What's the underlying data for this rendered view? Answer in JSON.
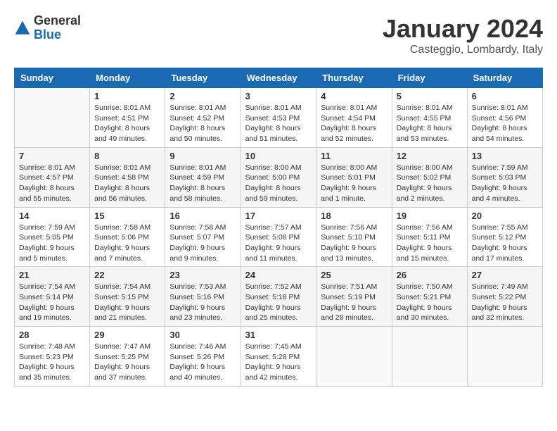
{
  "header": {
    "logo_general": "General",
    "logo_blue": "Blue",
    "month_year": "January 2024",
    "location": "Casteggio, Lombardy, Italy"
  },
  "calendar": {
    "days_of_week": [
      "Sunday",
      "Monday",
      "Tuesday",
      "Wednesday",
      "Thursday",
      "Friday",
      "Saturday"
    ],
    "weeks": [
      [
        {
          "day": "",
          "sunrise": "",
          "sunset": "",
          "daylight": ""
        },
        {
          "day": "1",
          "sunrise": "Sunrise: 8:01 AM",
          "sunset": "Sunset: 4:51 PM",
          "daylight": "Daylight: 8 hours and 49 minutes."
        },
        {
          "day": "2",
          "sunrise": "Sunrise: 8:01 AM",
          "sunset": "Sunset: 4:52 PM",
          "daylight": "Daylight: 8 hours and 50 minutes."
        },
        {
          "day": "3",
          "sunrise": "Sunrise: 8:01 AM",
          "sunset": "Sunset: 4:53 PM",
          "daylight": "Daylight: 8 hours and 51 minutes."
        },
        {
          "day": "4",
          "sunrise": "Sunrise: 8:01 AM",
          "sunset": "Sunset: 4:54 PM",
          "daylight": "Daylight: 8 hours and 52 minutes."
        },
        {
          "day": "5",
          "sunrise": "Sunrise: 8:01 AM",
          "sunset": "Sunset: 4:55 PM",
          "daylight": "Daylight: 8 hours and 53 minutes."
        },
        {
          "day": "6",
          "sunrise": "Sunrise: 8:01 AM",
          "sunset": "Sunset: 4:56 PM",
          "daylight": "Daylight: 8 hours and 54 minutes."
        }
      ],
      [
        {
          "day": "7",
          "sunrise": "Sunrise: 8:01 AM",
          "sunset": "Sunset: 4:57 PM",
          "daylight": "Daylight: 8 hours and 55 minutes."
        },
        {
          "day": "8",
          "sunrise": "Sunrise: 8:01 AM",
          "sunset": "Sunset: 4:58 PM",
          "daylight": "Daylight: 8 hours and 56 minutes."
        },
        {
          "day": "9",
          "sunrise": "Sunrise: 8:01 AM",
          "sunset": "Sunset: 4:59 PM",
          "daylight": "Daylight: 8 hours and 58 minutes."
        },
        {
          "day": "10",
          "sunrise": "Sunrise: 8:00 AM",
          "sunset": "Sunset: 5:00 PM",
          "daylight": "Daylight: 8 hours and 59 minutes."
        },
        {
          "day": "11",
          "sunrise": "Sunrise: 8:00 AM",
          "sunset": "Sunset: 5:01 PM",
          "daylight": "Daylight: 9 hours and 1 minute."
        },
        {
          "day": "12",
          "sunrise": "Sunrise: 8:00 AM",
          "sunset": "Sunset: 5:02 PM",
          "daylight": "Daylight: 9 hours and 2 minutes."
        },
        {
          "day": "13",
          "sunrise": "Sunrise: 7:59 AM",
          "sunset": "Sunset: 5:03 PM",
          "daylight": "Daylight: 9 hours and 4 minutes."
        }
      ],
      [
        {
          "day": "14",
          "sunrise": "Sunrise: 7:59 AM",
          "sunset": "Sunset: 5:05 PM",
          "daylight": "Daylight: 9 hours and 5 minutes."
        },
        {
          "day": "15",
          "sunrise": "Sunrise: 7:58 AM",
          "sunset": "Sunset: 5:06 PM",
          "daylight": "Daylight: 9 hours and 7 minutes."
        },
        {
          "day": "16",
          "sunrise": "Sunrise: 7:58 AM",
          "sunset": "Sunset: 5:07 PM",
          "daylight": "Daylight: 9 hours and 9 minutes."
        },
        {
          "day": "17",
          "sunrise": "Sunrise: 7:57 AM",
          "sunset": "Sunset: 5:08 PM",
          "daylight": "Daylight: 9 hours and 11 minutes."
        },
        {
          "day": "18",
          "sunrise": "Sunrise: 7:56 AM",
          "sunset": "Sunset: 5:10 PM",
          "daylight": "Daylight: 9 hours and 13 minutes."
        },
        {
          "day": "19",
          "sunrise": "Sunrise: 7:56 AM",
          "sunset": "Sunset: 5:11 PM",
          "daylight": "Daylight: 9 hours and 15 minutes."
        },
        {
          "day": "20",
          "sunrise": "Sunrise: 7:55 AM",
          "sunset": "Sunset: 5:12 PM",
          "daylight": "Daylight: 9 hours and 17 minutes."
        }
      ],
      [
        {
          "day": "21",
          "sunrise": "Sunrise: 7:54 AM",
          "sunset": "Sunset: 5:14 PM",
          "daylight": "Daylight: 9 hours and 19 minutes."
        },
        {
          "day": "22",
          "sunrise": "Sunrise: 7:54 AM",
          "sunset": "Sunset: 5:15 PM",
          "daylight": "Daylight: 9 hours and 21 minutes."
        },
        {
          "day": "23",
          "sunrise": "Sunrise: 7:53 AM",
          "sunset": "Sunset: 5:16 PM",
          "daylight": "Daylight: 9 hours and 23 minutes."
        },
        {
          "day": "24",
          "sunrise": "Sunrise: 7:52 AM",
          "sunset": "Sunset: 5:18 PM",
          "daylight": "Daylight: 9 hours and 25 minutes."
        },
        {
          "day": "25",
          "sunrise": "Sunrise: 7:51 AM",
          "sunset": "Sunset: 5:19 PM",
          "daylight": "Daylight: 9 hours and 28 minutes."
        },
        {
          "day": "26",
          "sunrise": "Sunrise: 7:50 AM",
          "sunset": "Sunset: 5:21 PM",
          "daylight": "Daylight: 9 hours and 30 minutes."
        },
        {
          "day": "27",
          "sunrise": "Sunrise: 7:49 AM",
          "sunset": "Sunset: 5:22 PM",
          "daylight": "Daylight: 9 hours and 32 minutes."
        }
      ],
      [
        {
          "day": "28",
          "sunrise": "Sunrise: 7:48 AM",
          "sunset": "Sunset: 5:23 PM",
          "daylight": "Daylight: 9 hours and 35 minutes."
        },
        {
          "day": "29",
          "sunrise": "Sunrise: 7:47 AM",
          "sunset": "Sunset: 5:25 PM",
          "daylight": "Daylight: 9 hours and 37 minutes."
        },
        {
          "day": "30",
          "sunrise": "Sunrise: 7:46 AM",
          "sunset": "Sunset: 5:26 PM",
          "daylight": "Daylight: 9 hours and 40 minutes."
        },
        {
          "day": "31",
          "sunrise": "Sunrise: 7:45 AM",
          "sunset": "Sunset: 5:28 PM",
          "daylight": "Daylight: 9 hours and 42 minutes."
        },
        {
          "day": "",
          "sunrise": "",
          "sunset": "",
          "daylight": ""
        },
        {
          "day": "",
          "sunrise": "",
          "sunset": "",
          "daylight": ""
        },
        {
          "day": "",
          "sunrise": "",
          "sunset": "",
          "daylight": ""
        }
      ]
    ]
  }
}
